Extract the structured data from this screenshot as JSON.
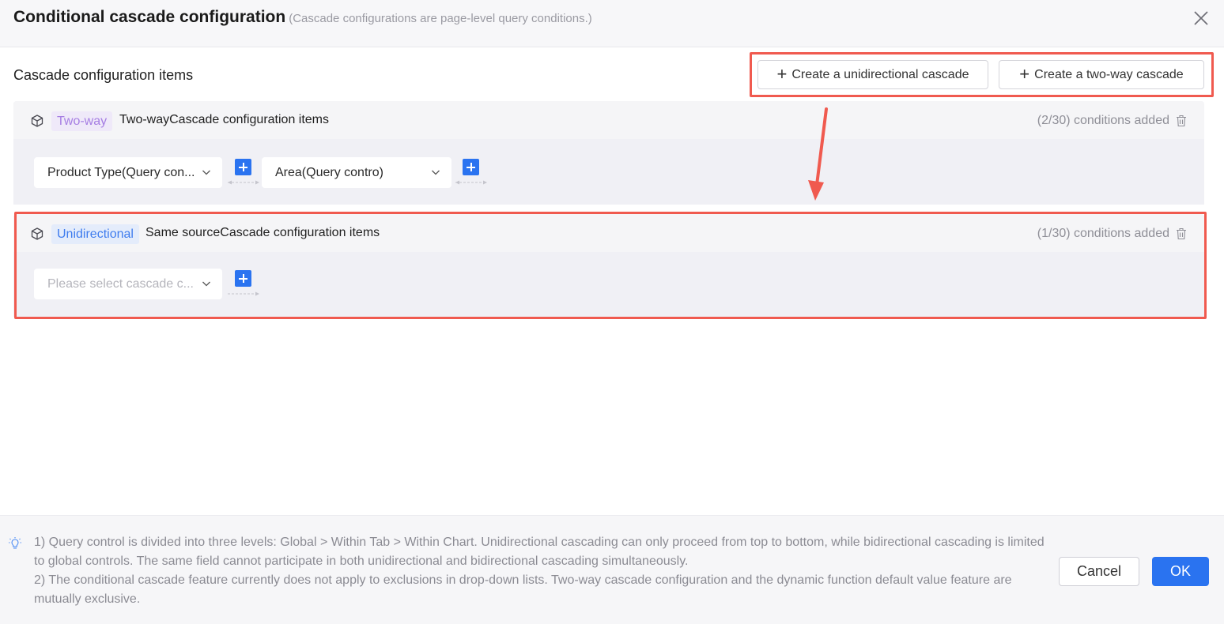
{
  "dialog": {
    "title": "Conditional cascade configuration",
    "subtitle": "(Cascade configurations are page-level query conditions.)",
    "close_icon": "close-icon"
  },
  "section": {
    "title": "Cascade configuration items",
    "create_unidirectional_label": "Create a unidirectional cascade",
    "create_two_way_label": "Create a two-way cascade",
    "highlight_color": "#f05a4f"
  },
  "cards": [
    {
      "tag": "Two-way",
      "label": "Two-wayCascade configuration items",
      "counter": "(2/30) conditions added",
      "selects": [
        {
          "value": "Product Type(Query con..."
        },
        {
          "value": "Area(Query contro)"
        }
      ]
    },
    {
      "tag": "Unidirectional",
      "label": "Same sourceCascade configuration items",
      "counter": "(1/30) conditions added",
      "selects": [
        {
          "placeholder": "Please select cascade c..."
        }
      ]
    }
  ],
  "footer": {
    "note1": "1) Query control is divided into three levels: Global > Within Tab > Within Chart. Unidirectional cascading can only proceed from top to bottom, while bidirectional cascading is limited to global controls. The same field cannot participate in both unidirectional and bidirectional cascading simultaneously.",
    "note2": "2) The conditional cascade feature currently does not apply to exclusions in drop-down lists. Two-way cascade configuration and the dynamic function default value feature are mutually exclusive.",
    "cancel_label": "Cancel",
    "ok_label": "OK"
  },
  "colors": {
    "primary": "#2a73f0",
    "two_way_tag": "#a67ee3",
    "unidirectional_tag": "#3f7cee",
    "annotation": "#f05a4f"
  }
}
